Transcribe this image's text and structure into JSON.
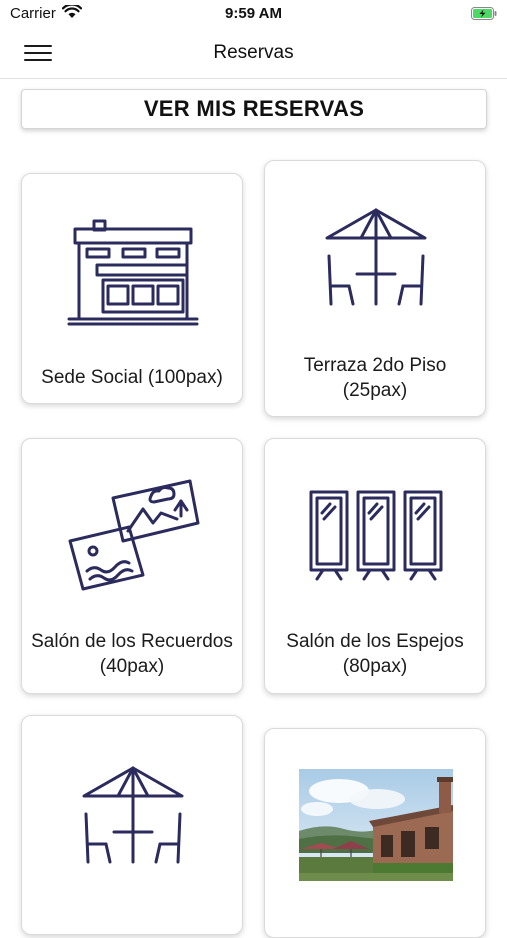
{
  "status_bar": {
    "carrier": "Carrier",
    "time": "9:59 AM",
    "wifi_icon": "wifi-icon",
    "battery_icon": "battery-charging-icon",
    "battery_color": "#4cd964"
  },
  "nav": {
    "title": "Reservas",
    "menu_icon": "hamburger-menu-icon"
  },
  "ver_reservas": {
    "label": "VER MIS RESERVAS"
  },
  "colors": {
    "icon_stroke": "#2b2b5e",
    "card_border": "#dadada",
    "background": "#ffffff"
  },
  "spaces": [
    {
      "label": "Sede Social (100pax)",
      "icon": "building-icon"
    },
    {
      "label": "Terraza 2do Piso (25pax)",
      "icon": "umbrella-table-icon"
    },
    {
      "label": "Salón de los Recuerdos (40pax)",
      "icon": "photos-icon"
    },
    {
      "label": "Salón de los Espejos (80pax)",
      "icon": "mirrors-icon"
    },
    {
      "label": "",
      "icon": "umbrella-table-icon"
    },
    {
      "label": "",
      "icon": "building-photo"
    }
  ]
}
